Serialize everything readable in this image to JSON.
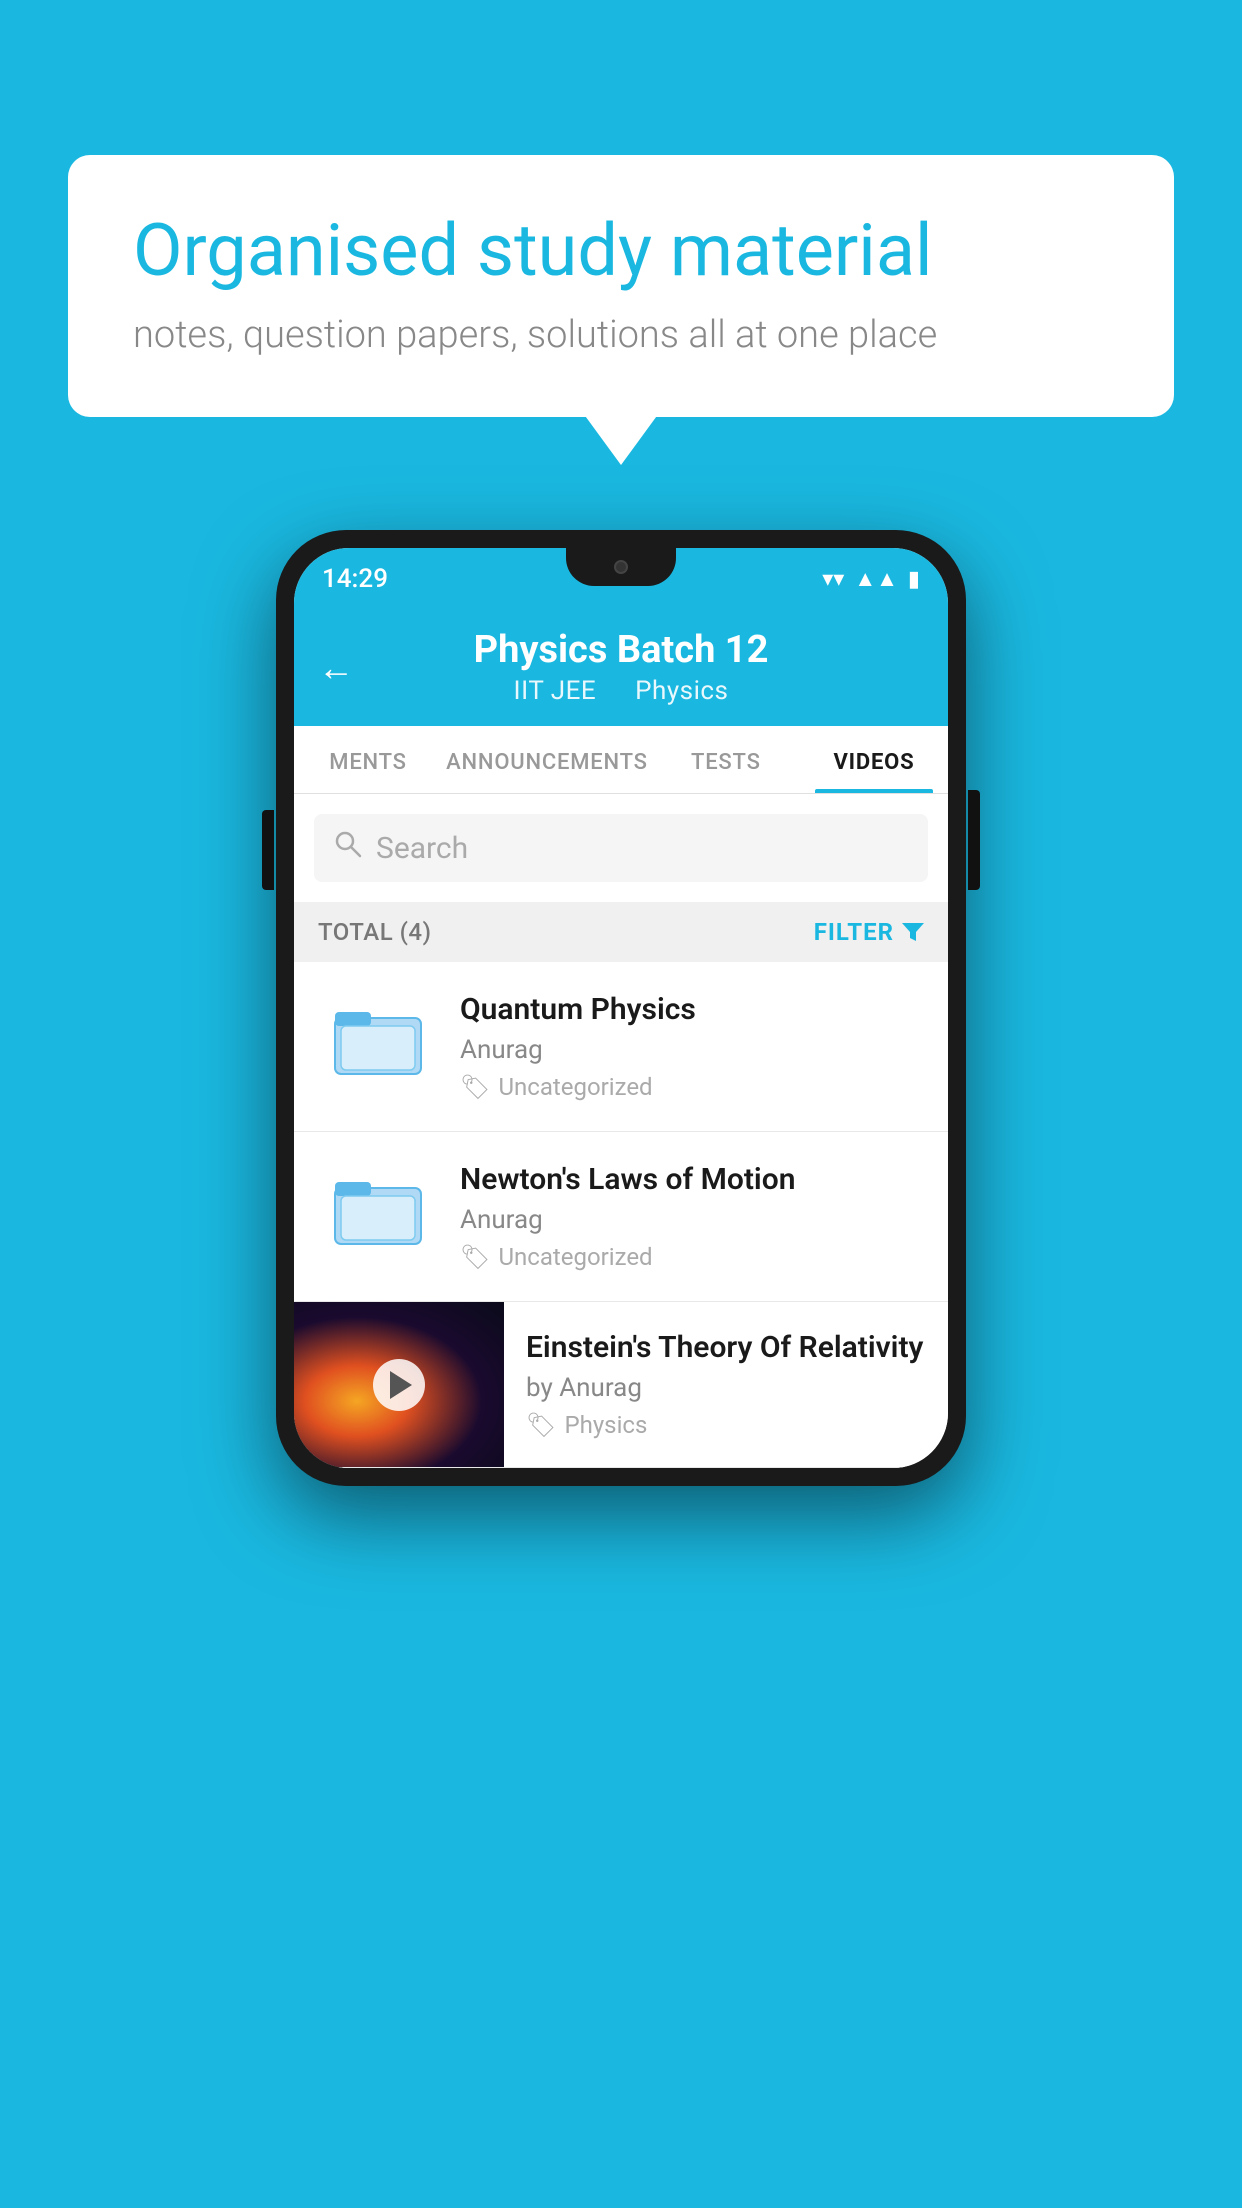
{
  "background": {
    "color": "#1ab8e0"
  },
  "speech_bubble": {
    "title": "Organised study material",
    "subtitle": "notes, question papers, solutions all at one place"
  },
  "status_bar": {
    "time": "14:29",
    "wifi_icon": "▲",
    "signal_icon": "▲",
    "battery_icon": "▮"
  },
  "app_header": {
    "back_label": "←",
    "title": "Physics Batch 12",
    "subtitle_part1": "IIT JEE",
    "subtitle_part2": "Physics"
  },
  "tabs": [
    {
      "label": "MENTS",
      "active": false
    },
    {
      "label": "ANNOUNCEMENTS",
      "active": false
    },
    {
      "label": "TESTS",
      "active": false
    },
    {
      "label": "VIDEOS",
      "active": true
    }
  ],
  "search": {
    "placeholder": "Search"
  },
  "filter_bar": {
    "total_label": "TOTAL (4)",
    "filter_label": "FILTER"
  },
  "videos": [
    {
      "id": 1,
      "title": "Quantum Physics",
      "author": "Anurag",
      "tag": "Uncategorized",
      "has_thumb": false
    },
    {
      "id": 2,
      "title": "Newton's Laws of Motion",
      "author": "Anurag",
      "tag": "Uncategorized",
      "has_thumb": false
    },
    {
      "id": 3,
      "title": "Einstein's Theory Of Relativity",
      "author_prefix": "by",
      "author": "Anurag",
      "tag": "Physics",
      "has_thumb": true
    }
  ]
}
